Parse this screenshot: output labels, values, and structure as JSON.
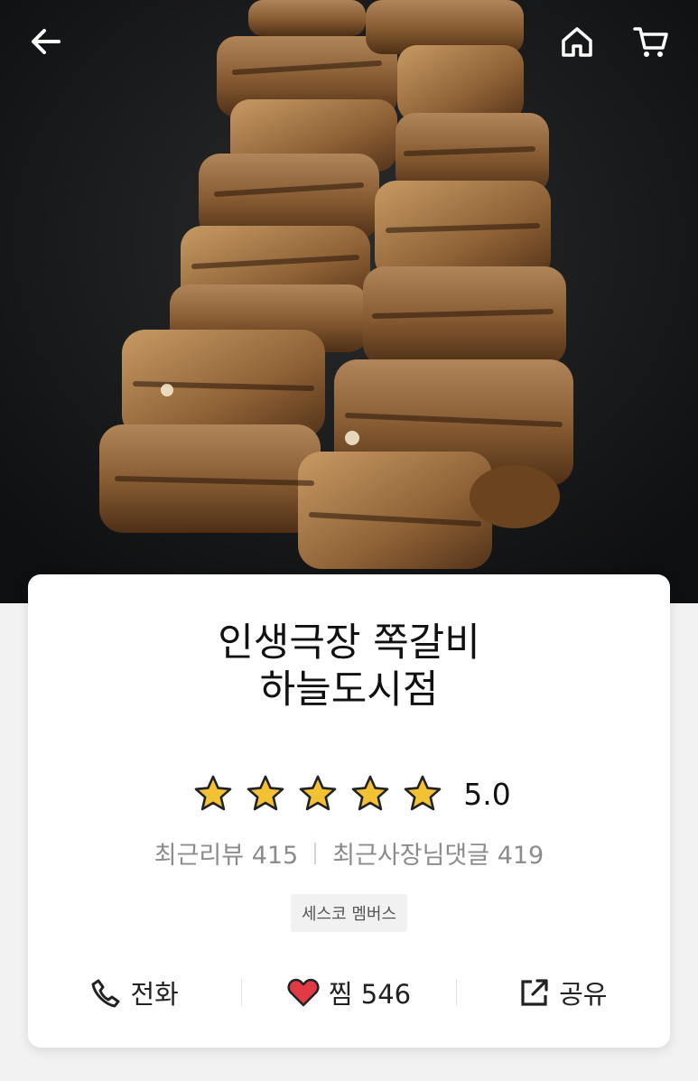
{
  "header": {
    "back_icon": "arrow-left-icon",
    "home_icon": "home-icon",
    "cart_icon": "cart-icon"
  },
  "hero": {
    "image": "grilled pork ribs on skewers"
  },
  "store": {
    "name_line1": "인생극장 쪽갈비",
    "name_line2": "하늘도시점",
    "rating": {
      "stars": 5,
      "max_stars": 5,
      "score": "5.0",
      "star_color": "#f3c234"
    },
    "recent_reviews": "최근리뷰 415",
    "owner_replies": "최근사장님댓글 419",
    "badge": "세스코 멤버스"
  },
  "actions": {
    "call_label": "전화",
    "like_label": "찜 546",
    "share_label": "공유",
    "heart_color": "#e03a46"
  }
}
